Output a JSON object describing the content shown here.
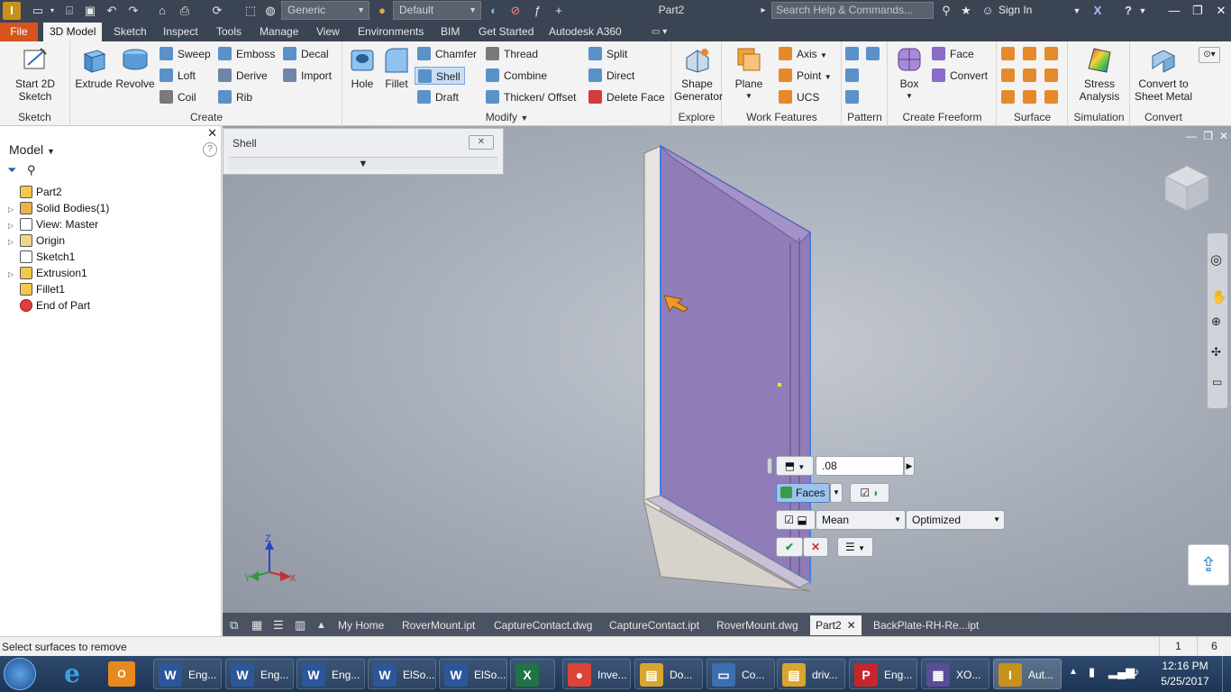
{
  "app": {
    "title": "Part2",
    "logo_letter": "I",
    "appearance": "Generic",
    "material": "Default",
    "help_placeholder": "Search Help & Commands...",
    "sign_in": "Sign In"
  },
  "ribbon_tabs": [
    "File",
    "3D Model",
    "Sketch",
    "Inspect",
    "Tools",
    "Manage",
    "View",
    "Environments",
    "BIM",
    "Get Started",
    "Autodesk A360"
  ],
  "panels": {
    "sketch": {
      "title": "Sketch",
      "start_sketch": "Start 2D Sketch"
    },
    "create": {
      "title": "Create",
      "extrude": "Extrude",
      "revolve": "Revolve",
      "sweep": "Sweep",
      "emboss": "Emboss",
      "decal": "Decal",
      "loft": "Loft",
      "derive": "Derive",
      "import": "Import",
      "coil": "Coil",
      "rib": "Rib"
    },
    "modify": {
      "title": "Modify",
      "hole": "Hole",
      "fillet": "Fillet",
      "chamfer": "Chamfer",
      "thread": "Thread",
      "split": "Split",
      "shell": "Shell",
      "combine": "Combine",
      "direct": "Direct",
      "draft": "Draft",
      "thicken": "Thicken/ Offset",
      "delete_face": "Delete Face"
    },
    "explore": {
      "title": "Explore",
      "shape_generator": "Shape Generator"
    },
    "work_features": {
      "title": "Work Features",
      "plane": "Plane",
      "axis": "Axis",
      "point": "Point",
      "ucs": "UCS"
    },
    "pattern": {
      "title": "Pattern"
    },
    "freeform": {
      "title": "Create Freeform",
      "box": "Box",
      "face": "Face",
      "convert": "Convert"
    },
    "surface": {
      "title": "Surface"
    },
    "simulation": {
      "title": "Simulation",
      "stress": "Stress Analysis"
    },
    "convert": {
      "title": "Convert",
      "sheet_metal": "Convert to Sheet Metal"
    }
  },
  "browser": {
    "title": "Model",
    "nodes": [
      {
        "label": "Part2",
        "expandable": false
      },
      {
        "label": "Solid Bodies(1)",
        "expandable": true
      },
      {
        "label": "View: Master",
        "expandable": true
      },
      {
        "label": "Origin",
        "expandable": true
      },
      {
        "label": "Sketch1",
        "expandable": false
      },
      {
        "label": "Extrusion1",
        "expandable": true
      },
      {
        "label": "Fillet1",
        "expandable": false
      },
      {
        "label": "End of Part",
        "expandable": false
      }
    ]
  },
  "shell_dialog": {
    "title": "Shell"
  },
  "minitoolbar": {
    "thickness": ".08",
    "faces": "Faces",
    "method": "Mean",
    "optimization": "Optimized"
  },
  "axes": {
    "x": "X",
    "y": "Y",
    "z": "Z"
  },
  "doc_tabs": [
    "My Home",
    "RoverMount.ipt",
    "CaptureContact.dwg",
    "CaptureContact.ipt",
    "RoverMount.dwg",
    "Part2",
    "BackPlate-RH-Re...ipt"
  ],
  "status": {
    "message": "Select surfaces to remove",
    "count1": "1",
    "count2": "6"
  },
  "taskbar": {
    "items": [
      {
        "label": "Eng...",
        "letter": "W",
        "color": "#2b579a"
      },
      {
        "label": "Eng...",
        "letter": "W",
        "color": "#2b579a"
      },
      {
        "label": "Eng...",
        "letter": "W",
        "color": "#2b579a"
      },
      {
        "label": "ElSo...",
        "letter": "W",
        "color": "#2b579a"
      },
      {
        "label": "ElSo...",
        "letter": "W",
        "color": "#2b579a"
      },
      {
        "label": "",
        "letter": "X",
        "color": "#217346"
      },
      {
        "label": "Inve...",
        "letter": "●",
        "color": "#db4437"
      },
      {
        "label": "Do...",
        "letter": "▤",
        "color": "#d9a531"
      },
      {
        "label": "Co...",
        "letter": "▭",
        "color": "#3c6fb0"
      },
      {
        "label": "driv...",
        "letter": "▤",
        "color": "#d9a531"
      },
      {
        "label": "Eng...",
        "letter": "P",
        "color": "#c7252b"
      },
      {
        "label": "XO...",
        "letter": "▦",
        "color": "#5a4d9a"
      },
      {
        "label": "Aut...",
        "letter": "I",
        "color": "#c8901c"
      }
    ],
    "time": "12:16 PM",
    "date": "5/25/2017"
  },
  "colors": {
    "accent": "#d9531e",
    "ribbon_bg": "#3b4453",
    "selection": "#7d6aa8",
    "highlight": "#2f7df0"
  }
}
